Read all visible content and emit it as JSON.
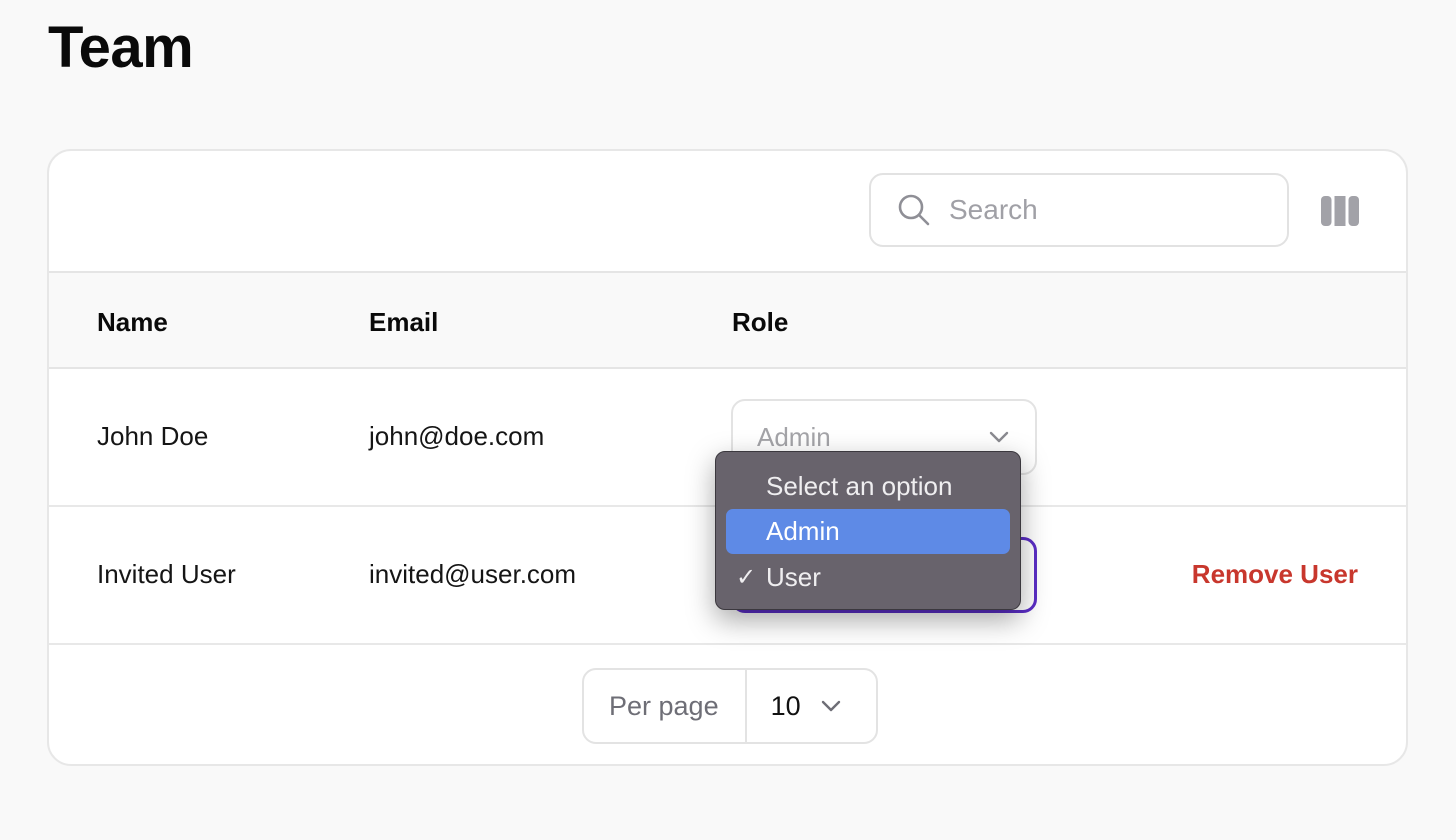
{
  "page": {
    "title": "Team"
  },
  "toolbar": {
    "search_placeholder": "Search",
    "search_value": "",
    "search_icon": "search-icon",
    "columns_icon": "columns-icon"
  },
  "table": {
    "headers": [
      "Name",
      "Email",
      "Role"
    ],
    "rows": [
      {
        "name": "John Doe",
        "email": "john@doe.com",
        "role": "Admin",
        "action": ""
      },
      {
        "name": "Invited User",
        "email": "invited@user.com",
        "role": "User",
        "action": "Remove User"
      }
    ]
  },
  "role_dropdown": {
    "options": [
      "Select an option",
      "Admin",
      "User"
    ],
    "highlighted": "Admin",
    "checked": "User",
    "check_glyph": "✓"
  },
  "pagination": {
    "per_page_label": "Per page",
    "per_page_value": "10"
  },
  "colors": {
    "accent_focus": "#5b2ec6",
    "danger": "#c8372d",
    "menu_highlight": "#5e8ae6"
  }
}
